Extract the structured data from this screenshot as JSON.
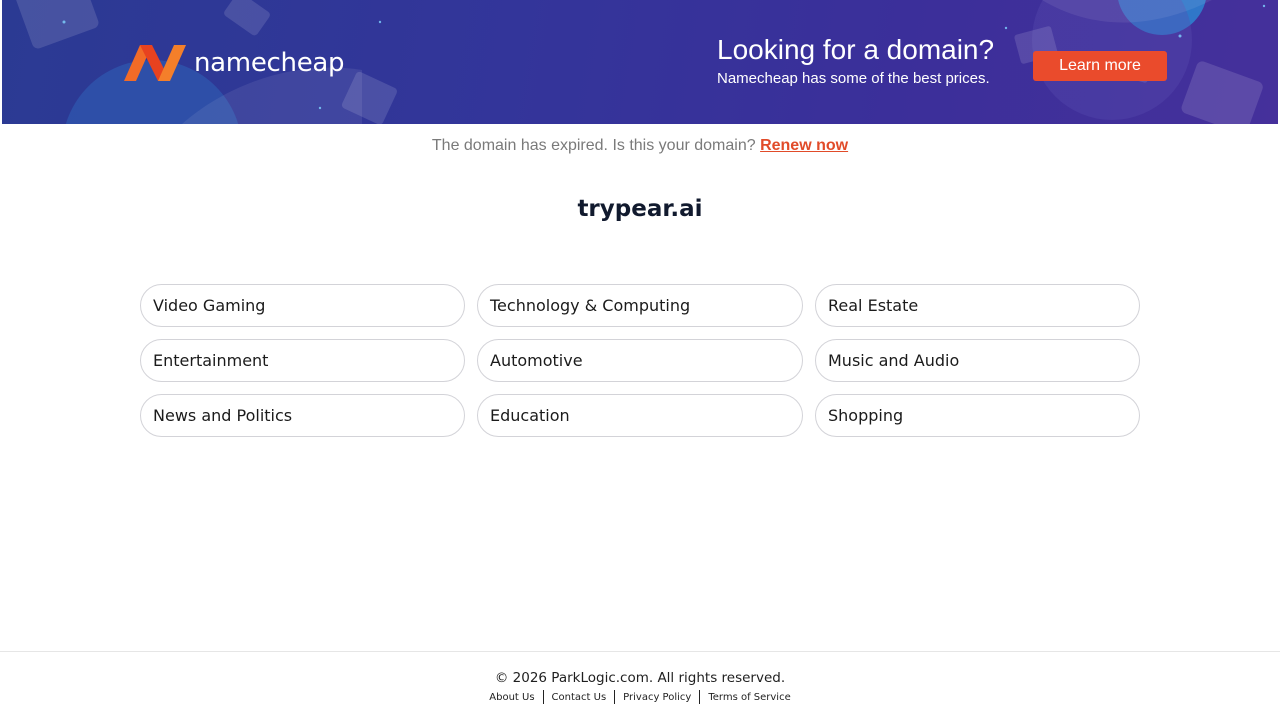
{
  "banner": {
    "brand": "namecheap",
    "promo_title": "Looking for a domain?",
    "promo_subtitle": "Namecheap has some of the best prices.",
    "learn_more_label": "Learn more",
    "colors": {
      "background": "#3a339a",
      "accent": "#ea4b2c",
      "logo_orange": "#f26b27"
    }
  },
  "notice": {
    "text": "The domain has expired. Is this your domain?",
    "renew_label": "Renew now"
  },
  "domain": "trypear.ai",
  "categories": [
    "Video Gaming",
    "Technology & Computing",
    "Real Estate",
    "Entertainment",
    "Automotive",
    "Music and Audio",
    "News and Politics",
    "Education",
    "Shopping"
  ],
  "footer": {
    "copyright": "© 2026 ParkLogic.com. All rights reserved.",
    "links": [
      "About Us",
      "Contact Us",
      "Privacy Policy",
      "Terms of Service"
    ]
  }
}
